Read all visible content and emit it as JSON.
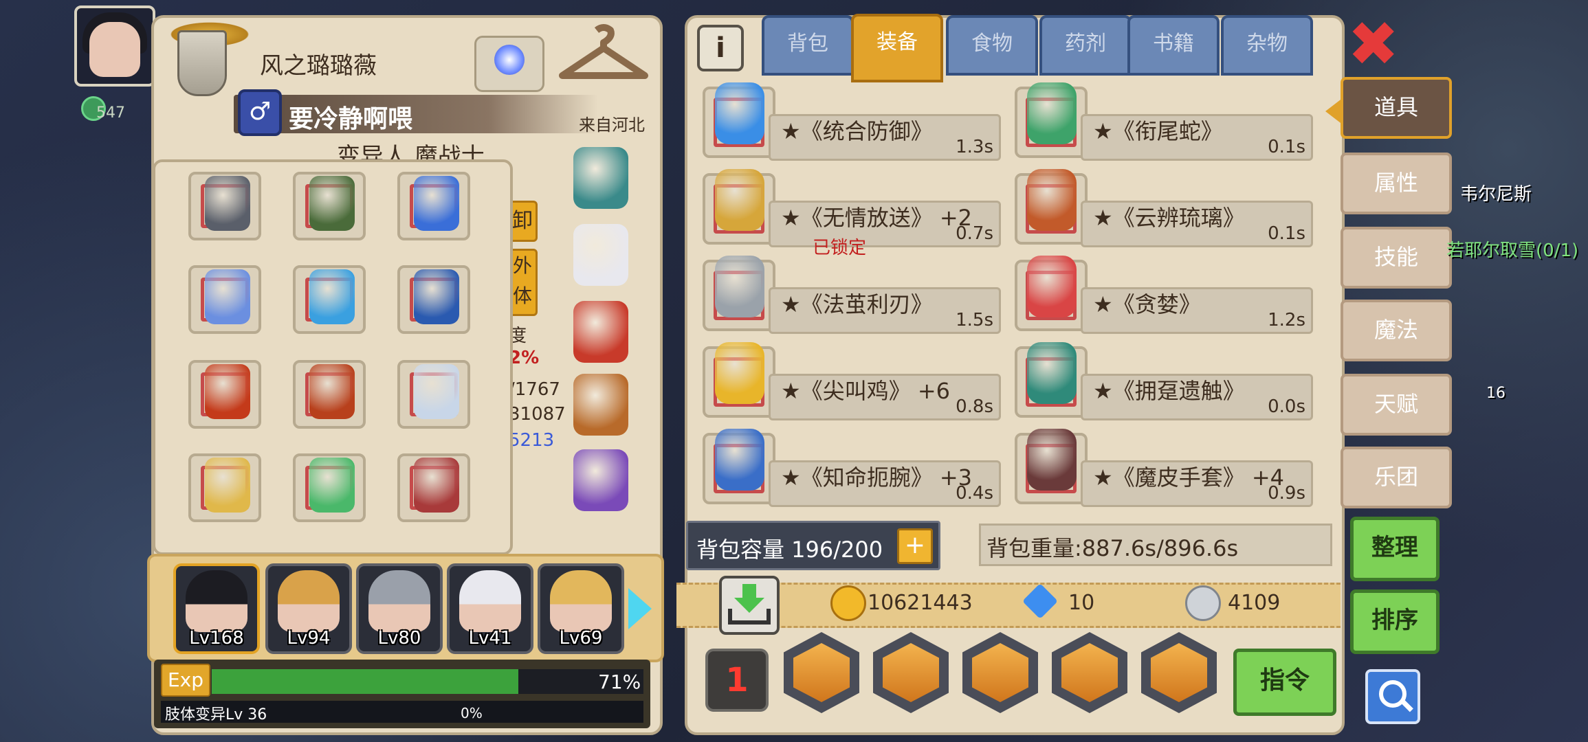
{
  "hud": {
    "level": "547"
  },
  "character": {
    "name": "风之璐璐薇",
    "subtitle": "要冷静啊喂",
    "gender_symbol": "♂",
    "origin": "来自河北",
    "race_class": "变异人 魔战士",
    "side_tags": [
      "卸",
      "外体"
    ],
    "side_stats": [
      "度",
      "2%",
      "/1767",
      "31087",
      "5213"
    ]
  },
  "party": [
    {
      "lv": "Lv168",
      "color": "#1c1c22"
    },
    {
      "lv": "Lv94",
      "color": "#d9a24a"
    },
    {
      "lv": "Lv80",
      "color": "#9aa0aa"
    },
    {
      "lv": "Lv41",
      "color": "#e8e8ee"
    },
    {
      "lv": "Lv69",
      "color": "#e2b75c"
    }
  ],
  "exp": {
    "label": "Exp",
    "percent_text": "71%",
    "fill": 0.71,
    "skill_label": "肢体变异Lv 36",
    "skill_percent": "0%"
  },
  "tabs": [
    "背包",
    "装备",
    "食物",
    "药剂",
    "书籍",
    "杂物"
  ],
  "active_tab": "装备",
  "items": [
    {
      "name": "★《统合防御》",
      "weight": "1.3s",
      "color": "#3a8ee6"
    },
    {
      "name": "★《衔尾蛇》",
      "weight": "0.1s",
      "color": "#3ea36a"
    },
    {
      "name": "★《无情放送》 +2",
      "weight": "0.7s",
      "locked": "已锁定",
      "color": "#d6a63a"
    },
    {
      "name": "★《云辨琉璃》",
      "weight": "0.1s",
      "color": "#c25a2a"
    },
    {
      "name": "★《法茧利刃》",
      "weight": "1.5s",
      "color": "#9aa2aa"
    },
    {
      "name": "★《贪婪》",
      "weight": "1.2s",
      "color": "#d94545"
    },
    {
      "name": "★《尖叫鸡》 +6",
      "weight": "0.8s",
      "color": "#e8b52a"
    },
    {
      "name": "★《拥趸遗触》",
      "weight": "0.0s",
      "color": "#2f8a7a"
    },
    {
      "name": "★《知命扼腕》 +3",
      "weight": "0.4s",
      "color": "#3a6ec8"
    },
    {
      "name": "★《魔皮手套》 +4",
      "weight": "0.9s",
      "color": "#6a3a3a"
    }
  ],
  "capacity": {
    "label": "背包容量 196/200",
    "plus": "+"
  },
  "weight": {
    "label": "背包重量:887.6s/896.6s"
  },
  "currency": {
    "gold": "10621443",
    "gems": "10",
    "silver": "4109"
  },
  "commands": {
    "sort_num": "1",
    "command": "指令"
  },
  "side_menu": [
    "道具",
    "属性",
    "技能",
    "魔法",
    "天赋",
    "乐团"
  ],
  "side_buttons": [
    "整理",
    "排序"
  ],
  "close": "✖",
  "info": "i",
  "map": {
    "npc": "韦尔尼斯",
    "quest": "若耶尔取雪(0/1)",
    "count": "16"
  },
  "equip_colors": [
    "#5a5f6a",
    "#4a6b3a",
    "#3a6ed8",
    "#6b8fe0",
    "#3aa0e0",
    "#2a5ab0",
    "#c43a1a",
    "#b8401c",
    "#c8d6e8",
    "#e0b84a",
    "#4ab86a",
    "#a83a3a"
  ],
  "side_equip_colors": [
    "#3a8a8a",
    "#e8e8ee",
    "#c83a2a",
    "#b86a2a",
    "#7a4ab8"
  ]
}
